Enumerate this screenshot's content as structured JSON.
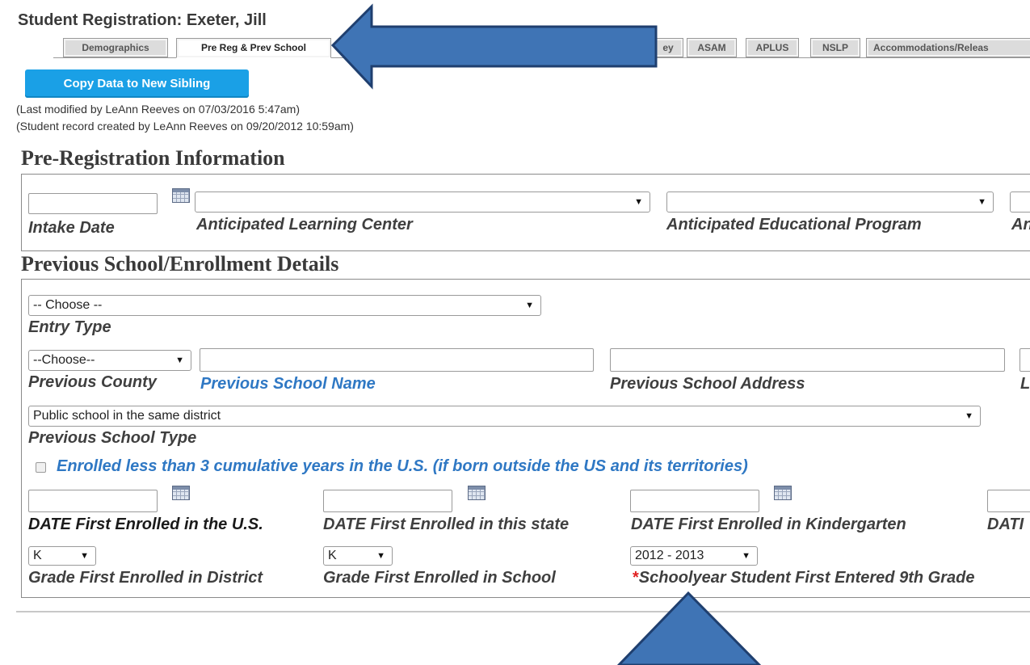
{
  "page": {
    "title": "Student Registration: Exeter, Jill",
    "copy_button": "Copy Data to New Sibling",
    "last_modified": "(Last modified by LeAnn Reeves on 07/03/2016 5:47am)",
    "created": "(Student record created by LeAnn Reeves on 09/20/2012 10:59am)"
  },
  "tabs": [
    {
      "label": "Demographics",
      "active": false
    },
    {
      "label": "Pre Reg & Prev School",
      "active": true
    },
    {
      "label": "ey",
      "active": false
    },
    {
      "label": "ASAM",
      "active": false
    },
    {
      "label": "APLUS",
      "active": false
    },
    {
      "label": "NSLP",
      "active": false
    },
    {
      "label": "Accommodations/Releas",
      "active": false
    }
  ],
  "prereg": {
    "heading": "Pre-Registration Information",
    "intake_date_label": "Intake Date",
    "intake_date_value": "",
    "learning_center_label": "Anticipated Learning Center",
    "learning_center_value": "",
    "edu_program_label": "Anticipated Educational Program",
    "edu_program_value": "",
    "cut_label": "An"
  },
  "previous": {
    "heading": "Previous School/Enrollment Details",
    "entry_type_value": "-- Choose --",
    "entry_type_label": "Entry Type",
    "county_value": "--Choose--",
    "county_label": "Previous County",
    "school_name_label": "Previous School Name",
    "school_address_label": "Previous School Address",
    "cut_label_l": "L",
    "school_type_value": "Public school in the same district",
    "school_type_label": "Previous School Type",
    "checkbox_label": "Enrolled less than 3 cumulative years in the U.S. (if born outside the US and its territories)",
    "date_us_label": "DATE First Enrolled in the U.S.",
    "date_state_label": "DATE First Enrolled in this state",
    "date_k_label": "DATE First Enrolled in Kindergarten",
    "date_cut_label": "DATI",
    "grade_district_value": "K",
    "grade_district_label": "Grade First Enrolled in District",
    "grade_school_value": "K",
    "grade_school_label": "Grade First Enrolled in School",
    "schoolyear_value": "2012 - 2013",
    "schoolyear_required": "*",
    "schoolyear_label": "Schoolyear Student First Entered 9th Grade"
  },
  "annotation": {
    "arrow_color": "#3f74b5"
  }
}
